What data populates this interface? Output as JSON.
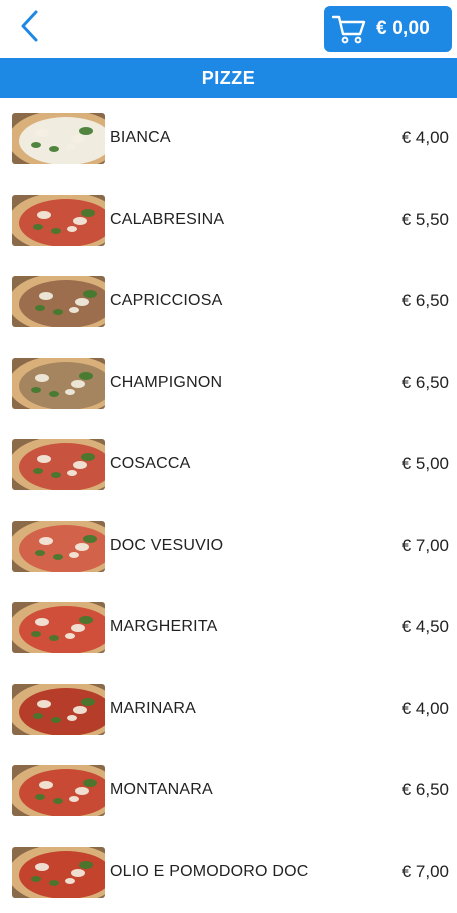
{
  "header": {
    "back_icon": "chevron-left-icon",
    "cart_icon": "shopping-cart-icon",
    "cart_total": "€ 0,00",
    "accent_color": "#1e88e5"
  },
  "category": {
    "title": "PIZZE"
  },
  "items": [
    {
      "name": "BIANCA",
      "price": "€ 4,00",
      "sauce": "#f1ece0"
    },
    {
      "name": "CALABRESINA",
      "price": "€ 5,50",
      "sauce": "#c9503a"
    },
    {
      "name": "CAPRICCIOSA",
      "price": "€ 6,50",
      "sauce": "#9c6e4e"
    },
    {
      "name": "CHAMPIGNON",
      "price": "€ 6,50",
      "sauce": "#a5855f"
    },
    {
      "name": "COSACCA",
      "price": "€ 5,00",
      "sauce": "#c8533e"
    },
    {
      "name": "DOC VESUVIO",
      "price": "€ 7,00",
      "sauce": "#d3624a"
    },
    {
      "name": "MARGHERITA",
      "price": "€ 4,50",
      "sauce": "#cf4f3a"
    },
    {
      "name": "MARINARA",
      "price": "€ 4,00",
      "sauce": "#b53d2a"
    },
    {
      "name": "MONTANARA",
      "price": "€ 6,50",
      "sauce": "#c84a34"
    },
    {
      "name": "OLIO E POMODORO DOC",
      "price": "€ 7,00",
      "sauce": "#c3432d"
    }
  ]
}
